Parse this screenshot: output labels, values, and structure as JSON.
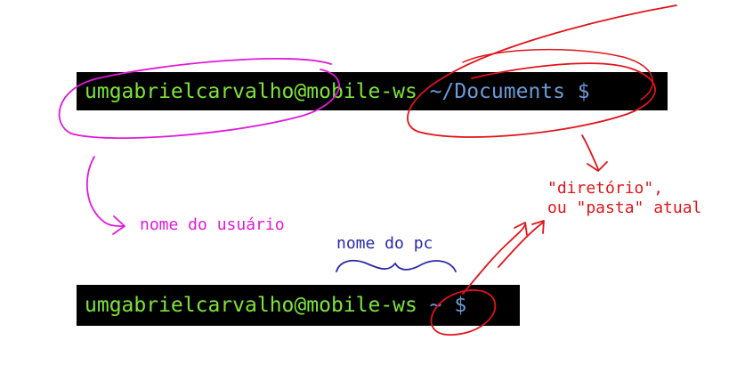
{
  "terminals": [
    {
      "user_host": "umgabrielcarvalho@mobile-ws",
      "path": "~/Documents",
      "prompt": "$"
    },
    {
      "user_host": "umgabrielcarvalho@mobile-ws",
      "path": "~",
      "prompt": "$"
    }
  ],
  "annotations": {
    "user": "nome do usuário",
    "pc": "nome do pc",
    "directory_line1": "\"diretório\",",
    "directory_line2": "ou \"pasta\" atual"
  },
  "colors": {
    "terminal_bg": "#000000",
    "user_host_text": "#7ee43a",
    "path_text": "#6b9bd8",
    "user_annotation": "#e01ad9",
    "pc_annotation": "#2a2aa8",
    "directory_annotation": "#e0141a"
  }
}
